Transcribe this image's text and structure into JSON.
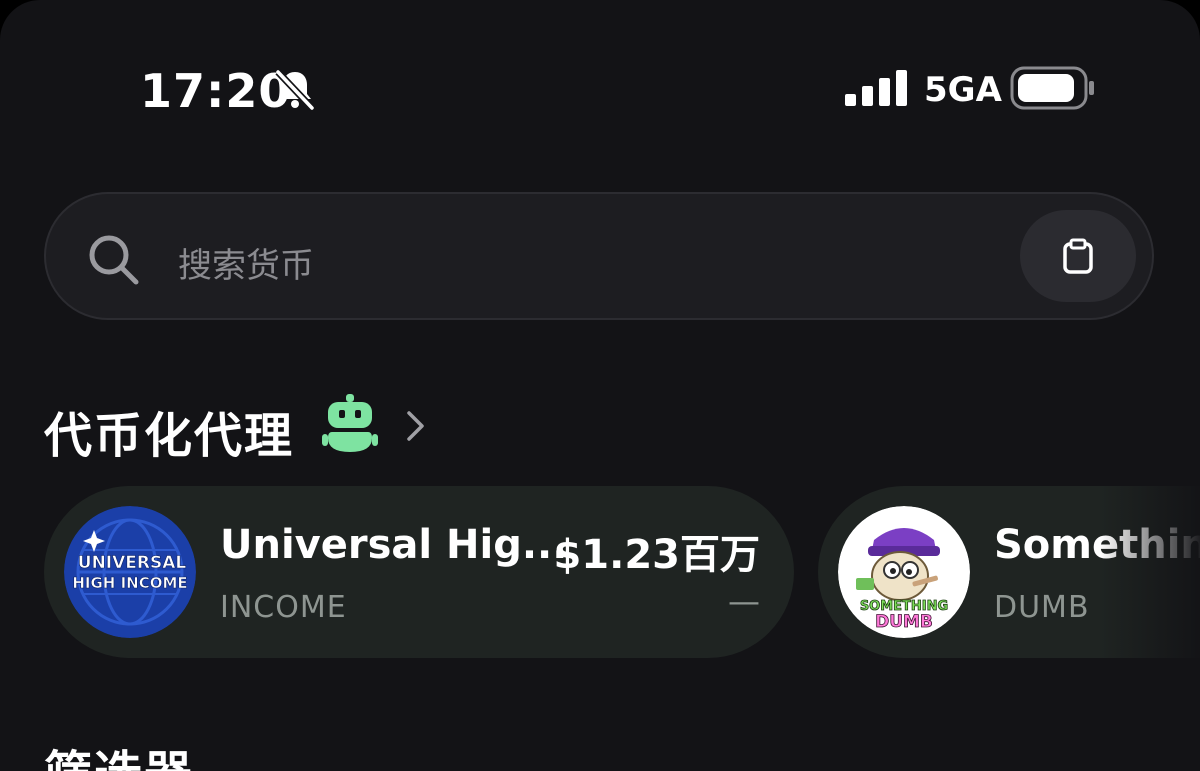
{
  "status_bar": {
    "time": "17:20",
    "network": "5GA",
    "icons": [
      "bell-slash-icon",
      "signal-icon",
      "battery-icon"
    ]
  },
  "search": {
    "placeholder": "搜索货币",
    "icon": "search-icon",
    "paste_icon": "clipboard-icon"
  },
  "section": {
    "title": "代币化代理",
    "icon": "robot-icon",
    "accent_color": "#7ee3a1"
  },
  "tokens": [
    {
      "name": "Universal Hig...",
      "ticker": "INCOME",
      "value": "$1.23百万",
      "change": "—",
      "avatar_text": [
        "UNIVERSAL",
        "HIGH INCOME"
      ]
    },
    {
      "name": "Somethin",
      "ticker": "DUMB",
      "avatar_text": [
        "SOMETHING",
        "DUMB"
      ]
    }
  ],
  "filter": {
    "title": "筛选器"
  },
  "colors": {
    "background": "#131316",
    "card": "#1f2422",
    "search_bg": "#1d1d21",
    "muted_text": "#8e9591"
  }
}
